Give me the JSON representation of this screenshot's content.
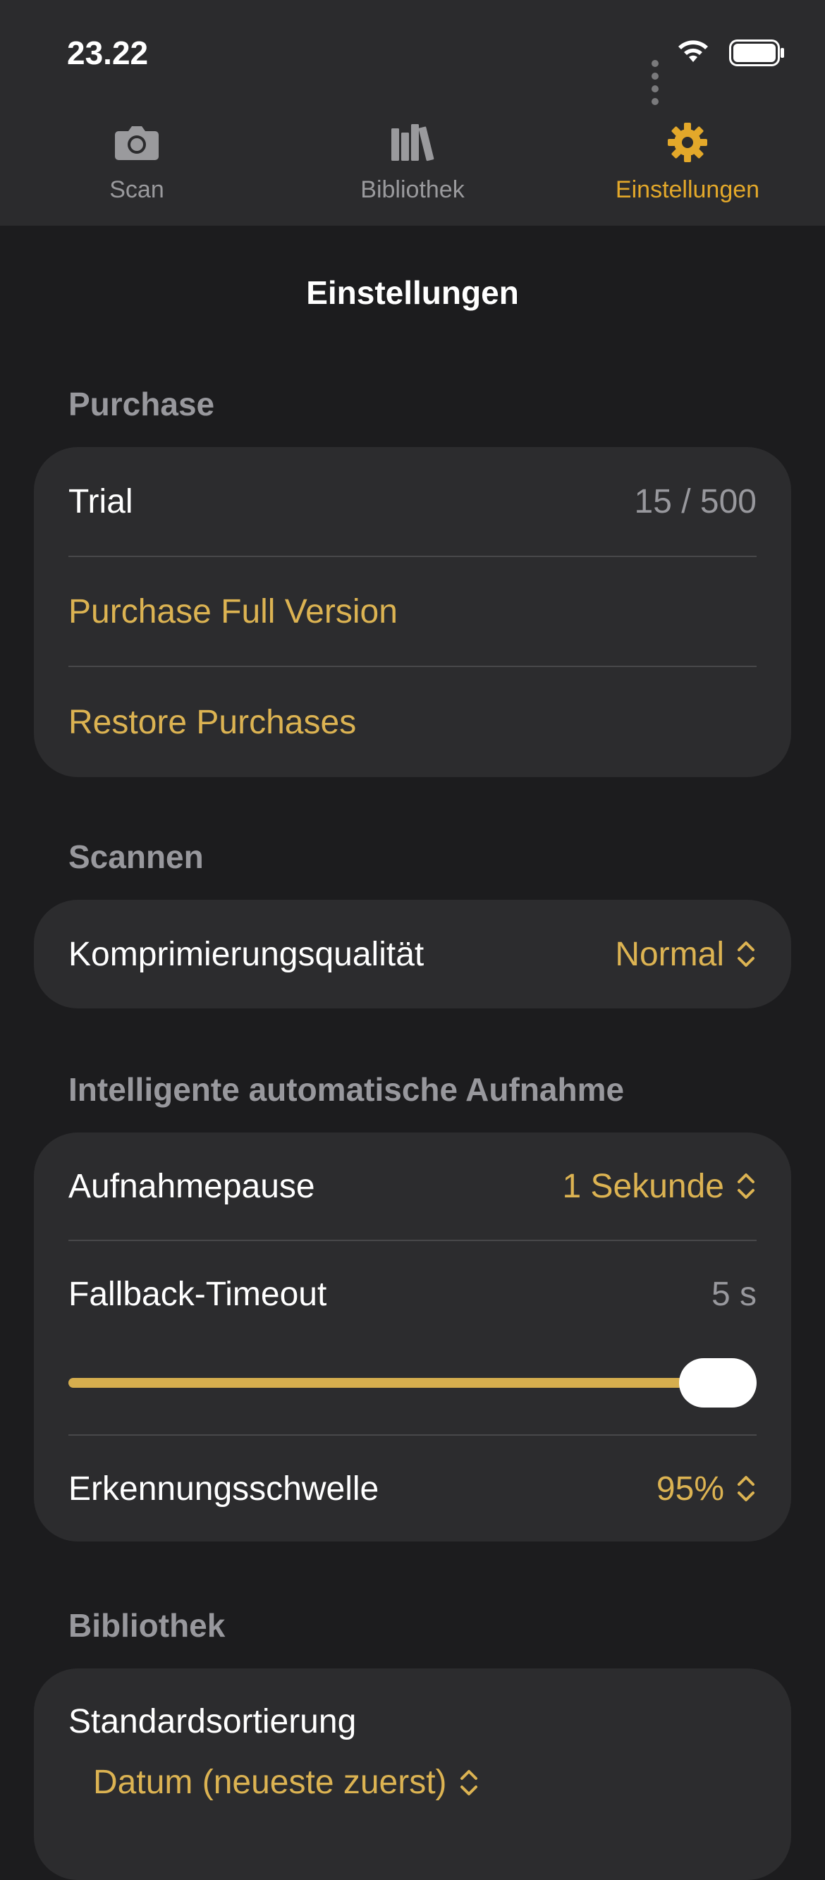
{
  "status_bar": {
    "time": "23.22"
  },
  "tabs": [
    {
      "label": "Scan",
      "icon": "camera-icon"
    },
    {
      "label": "Bibliothek",
      "icon": "books-icon"
    },
    {
      "label": "Einstellungen",
      "icon": "gear-icon",
      "active": true
    }
  ],
  "page": {
    "title": "Einstellungen"
  },
  "purchase": {
    "header": "Purchase",
    "trial_label": "Trial",
    "trial_value": "15 / 500",
    "full_version": "Purchase Full Version",
    "restore": "Restore Purchases"
  },
  "scannen": {
    "header": "Scannen",
    "quality_label": "Komprimierungsqualität",
    "quality_value": "Normal"
  },
  "auto_capture": {
    "header": "Intelligente automatische Aufnahme",
    "pause_label": "Aufnahmepause",
    "pause_value": "1 Sekunde",
    "fallback_label": "Fallback-Timeout",
    "fallback_value": "5 s",
    "fallback_slider_fraction": 1.0,
    "threshold_label": "Erkennungsschwelle",
    "threshold_value": "95%"
  },
  "bibliothek": {
    "header": "Bibliothek",
    "sort_label": "Standardsortierung",
    "sort_value": "Datum (neueste zuerst)"
  },
  "colors": {
    "accent": "#e3a82a",
    "link": "#dcb352",
    "background": "#1c1c1e",
    "card": "#2c2c2e"
  }
}
